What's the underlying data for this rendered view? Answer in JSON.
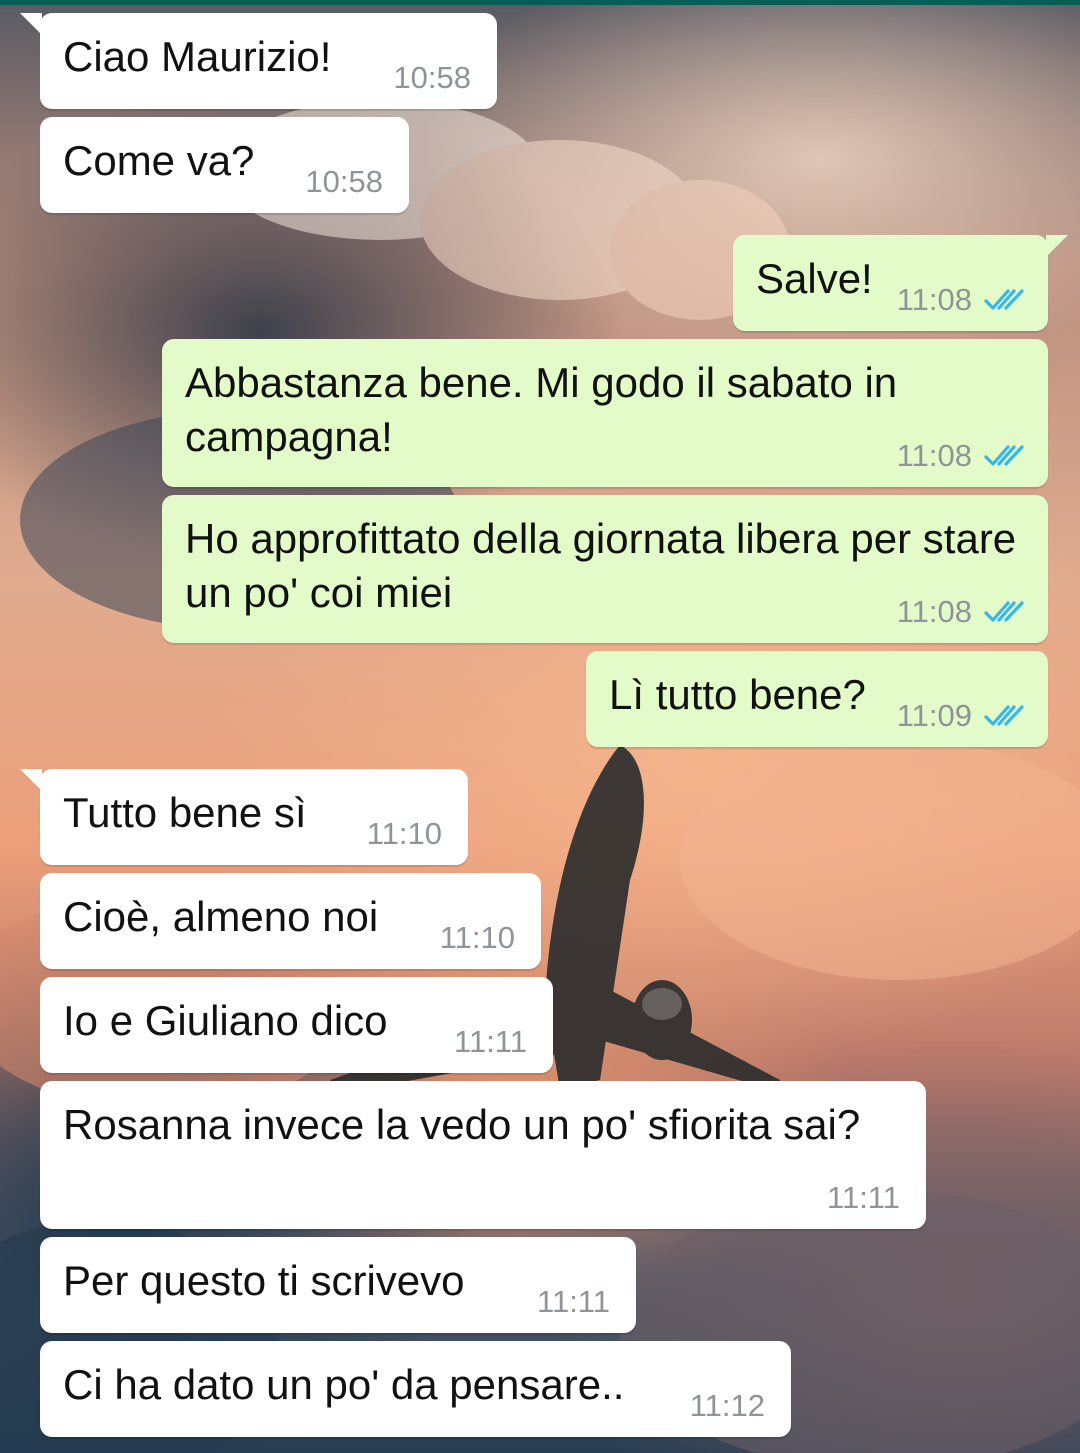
{
  "colors": {
    "incoming_bubble": "#ffffff",
    "outgoing_bubble": "#e2fbc9",
    "timestamp": "#8e9497",
    "read_ticks": "#34b7f1",
    "header_strip": "#075e54"
  },
  "icons": {
    "read_receipt": "double-check-icon"
  },
  "messages": [
    {
      "direction": "in",
      "text": "Ciao Maurizio!",
      "time": "10:58"
    },
    {
      "direction": "in",
      "text": "Come va?",
      "time": "10:58"
    },
    {
      "direction": "out",
      "text": "Salve!",
      "time": "11:08",
      "status": "read"
    },
    {
      "direction": "out",
      "text": "Abbastanza bene. Mi godo il sabato in campagna!",
      "time": "11:08",
      "status": "read"
    },
    {
      "direction": "out",
      "text": "Ho approfittato della giornata libera per stare un po' coi miei",
      "time": "11:08",
      "status": "read"
    },
    {
      "direction": "out",
      "text": "Lì tutto bene?",
      "time": "11:09",
      "status": "read"
    },
    {
      "direction": "in",
      "text": "Tutto bene sì",
      "time": "11:10"
    },
    {
      "direction": "in",
      "text": "Cioè, almeno noi",
      "time": "11:10"
    },
    {
      "direction": "in",
      "text": "Io e Giuliano dico",
      "time": "11:11"
    },
    {
      "direction": "in",
      "text": "Rosanna invece la vedo un po' sfiorita sai?",
      "time": "11:11"
    },
    {
      "direction": "in",
      "text": "Per questo ti scrivevo",
      "time": "11:11"
    },
    {
      "direction": "in",
      "text": "Ci ha dato un po' da pensare..",
      "time": "11:12"
    }
  ]
}
